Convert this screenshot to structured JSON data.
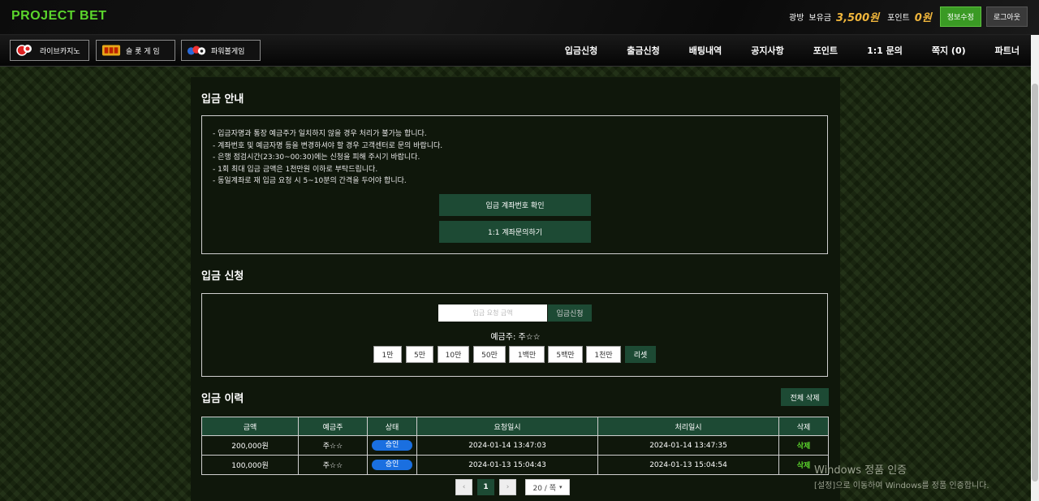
{
  "header": {
    "logo": "PROJECT BET",
    "user_name": "광방",
    "balance_label": "보유금",
    "balance_value": "3,500원",
    "point_label": "포인트",
    "point_value": "0원",
    "edit_button": "정보수정",
    "logout_button": "로그아웃"
  },
  "games": [
    {
      "label": "라이브카지노",
      "icon": "casino-chips-icon"
    },
    {
      "label": "슬 롯 게 임",
      "icon": "slot-machine-icon"
    },
    {
      "label": "파워볼게임",
      "icon": "powerball-icon"
    }
  ],
  "nav": [
    "입금신청",
    "출금신청",
    "배팅내역",
    "공지사항",
    "포인트",
    "1:1 문의",
    "쪽지 (0)",
    "파트너"
  ],
  "guide": {
    "title": "입금 안내",
    "lines": [
      "- 입금자명과 통장 예금주가 일치하지 않을 경우 처리가 불가능 합니다.",
      "- 계좌번호 및 예금자명 등을 변경하셔야 할 경우 고객센터로 문의 바랍니다.",
      "- 은행 점검시간(23:30~00:30)에는 신청을 피해 주시기 바랍니다.",
      "- 1회 최대 입금 금액은 1천만원 이하로 부탁드립니다.",
      "- 동일계좌로 재 입금 요청 시 5~10분의 간격을 두어야 합니다."
    ],
    "check_account_button": "입금 계좌번호 확인",
    "inquiry_button": "1:1 계좌문의하기"
  },
  "request": {
    "title": "입금 신청",
    "amount_placeholder": "입금 요청 금액",
    "apply_button": "입금신청",
    "holder_text": "예금주: 주☆☆",
    "chips": [
      "1만",
      "5만",
      "10만",
      "50만",
      "1백만",
      "5백만",
      "1천만"
    ],
    "reset_button": "리셋"
  },
  "history": {
    "title": "입금 이력",
    "delete_all_button": "전체 삭제",
    "columns": [
      "금액",
      "예금주",
      "상태",
      "요청일시",
      "처리일시",
      "삭제"
    ],
    "rows": [
      {
        "amount": "200,000원",
        "holder": "주☆☆",
        "status": "승인",
        "requested": "2024-01-14 13:47:03",
        "processed": "2024-01-14 13:47:35",
        "delete": "삭제"
      },
      {
        "amount": "100,000원",
        "holder": "주☆☆",
        "status": "승인",
        "requested": "2024-01-13 15:04:43",
        "processed": "2024-01-13 15:04:54",
        "delete": "삭제"
      }
    ]
  },
  "pagination": {
    "prev": "‹",
    "current": "1",
    "next": "›",
    "per_page": "20 / 쪽"
  },
  "watermark": {
    "line1": "Windows 정품 인증",
    "line2": "[설정]으로 이동하여 Windows를 정품 인증합니다."
  }
}
